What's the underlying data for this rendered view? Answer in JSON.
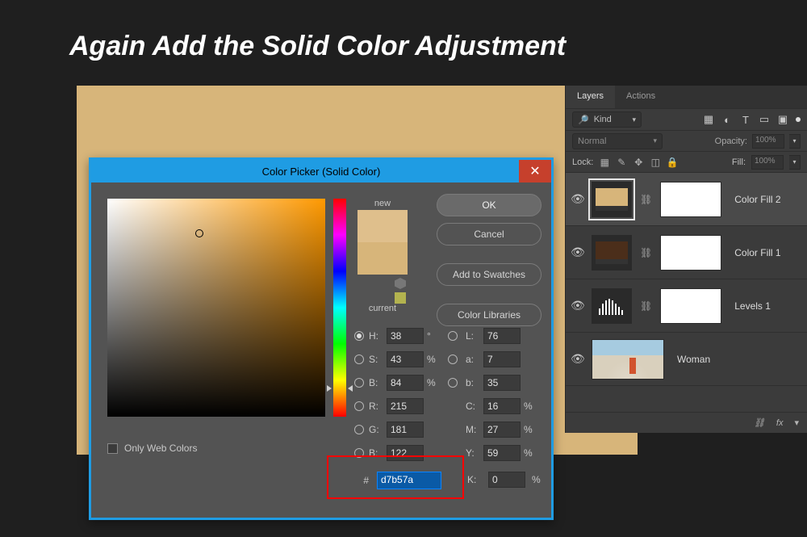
{
  "headline": "Again Add the Solid Color Adjustment",
  "picker": {
    "title": "Color Picker (Solid Color)",
    "new_label": "new",
    "current_label": "current",
    "new_color": "#dfbf8c",
    "current_color": "#d7b57a",
    "only_web_colors": "Only Web Colors",
    "target_xy_pct": [
      42.3,
      16.0
    ],
    "hue_handle_pct": 87.0,
    "buttons": {
      "ok": "OK",
      "cancel": "Cancel",
      "add_to_swatches": "Add to Swatches",
      "color_libraries": "Color Libraries"
    },
    "fields": {
      "H": {
        "label": "H:",
        "value": "38",
        "unit": "°",
        "selected": true
      },
      "S": {
        "label": "S:",
        "value": "43",
        "unit": "%",
        "selected": false
      },
      "B": {
        "label": "B:",
        "value": "84",
        "unit": "%",
        "selected": false
      },
      "L": {
        "label": "L:",
        "value": "76",
        "unit": "",
        "selected": false
      },
      "a": {
        "label": "a:",
        "value": "7",
        "unit": "",
        "selected": false
      },
      "b": {
        "label": "b:",
        "value": "35",
        "unit": "",
        "selected": false
      },
      "R": {
        "label": "R:",
        "value": "215",
        "unit": "",
        "selected": false
      },
      "G": {
        "label": "G:",
        "value": "181",
        "unit": "",
        "selected": false
      },
      "Bch": {
        "label": "B:",
        "value": "122",
        "unit": "",
        "selected": false
      },
      "C": {
        "label": "C:",
        "value": "16",
        "unit": "%"
      },
      "M": {
        "label": "M:",
        "value": "27",
        "unit": "%"
      },
      "Y": {
        "label": "Y:",
        "value": "59",
        "unit": "%"
      },
      "K": {
        "label": "K:",
        "value": "0",
        "unit": "%"
      },
      "hex": {
        "label": "#",
        "value": "d7b57a"
      }
    }
  },
  "layers_panel": {
    "tabs": {
      "layers": "Layers",
      "actions": "Actions"
    },
    "kind_label": "Kind",
    "blend_mode": "Normal",
    "opacity_label": "Opacity:",
    "opacity_value": "100%",
    "lock_label": "Lock:",
    "fill_label": "Fill:",
    "fill_value": "100%",
    "items": [
      {
        "name": "Color Fill 2",
        "type": "solid",
        "chip_color": "#d7b57a",
        "selected": true,
        "visible": true
      },
      {
        "name": "Color Fill 1",
        "type": "solid",
        "chip_color": "#4b2e1a",
        "selected": false,
        "visible": true
      },
      {
        "name": "Levels 1",
        "type": "levels",
        "chip_color": "",
        "selected": false,
        "visible": true
      },
      {
        "name": "Woman",
        "type": "image",
        "chip_color": "",
        "selected": false,
        "visible": true
      }
    ],
    "footer_icons": [
      "link",
      "fx"
    ]
  },
  "canvas_color": "#d7b57a"
}
